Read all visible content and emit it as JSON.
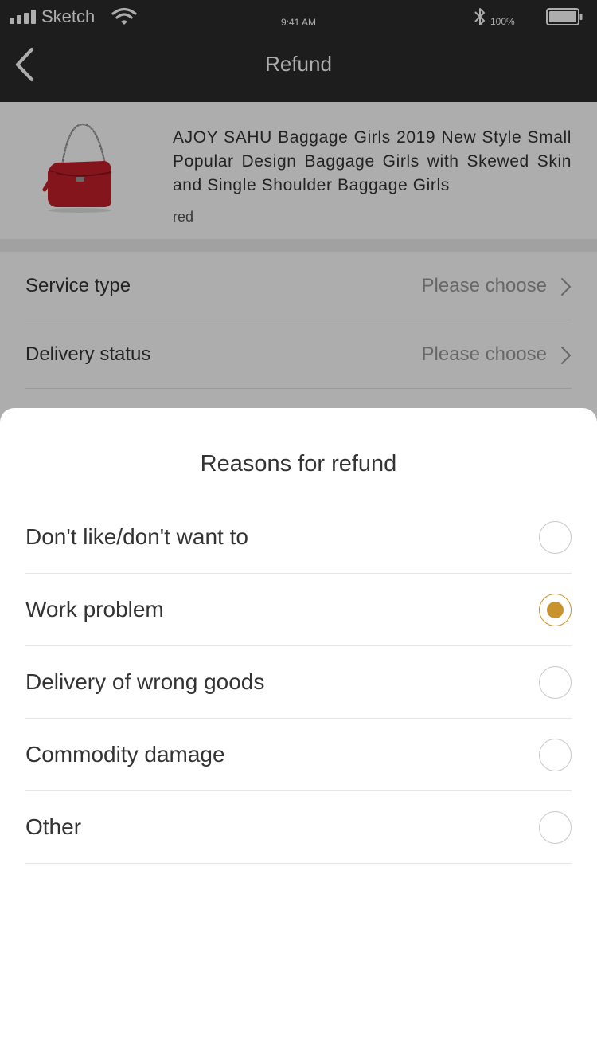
{
  "status_bar": {
    "carrier": "Sketch",
    "time": "9:41 AM",
    "battery": "100%",
    "icons": [
      "signal-icon",
      "wifi-icon",
      "bluetooth-icon",
      "battery-icon"
    ]
  },
  "nav": {
    "title": "Refund",
    "back_icon": "chevron-left-icon"
  },
  "product": {
    "title": "AJOY SAHU Baggage Girls 2019 New Style Small Popular Design Baggage Girls with Skewed Skin and Single Shoulder Baggage Girls",
    "variant": "red",
    "image": "red-handbag-image"
  },
  "form": {
    "rows": [
      {
        "label": "Service type",
        "value": "Please choose"
      },
      {
        "label": "Delivery status",
        "value": "Please choose"
      }
    ]
  },
  "sheet": {
    "title": "Reasons for refund",
    "reasons": [
      {
        "label": "Don't like/don't want to",
        "selected": false
      },
      {
        "label": "Work problem",
        "selected": true
      },
      {
        "label": "Delivery of wrong goods",
        "selected": false
      },
      {
        "label": "Commodity damage",
        "selected": false
      },
      {
        "label": "Other",
        "selected": false
      }
    ]
  },
  "colors": {
    "header_bg": "#2b2b2b",
    "accent": "#c8922f",
    "overlay": "rgba(0,0,0,0.32)"
  }
}
